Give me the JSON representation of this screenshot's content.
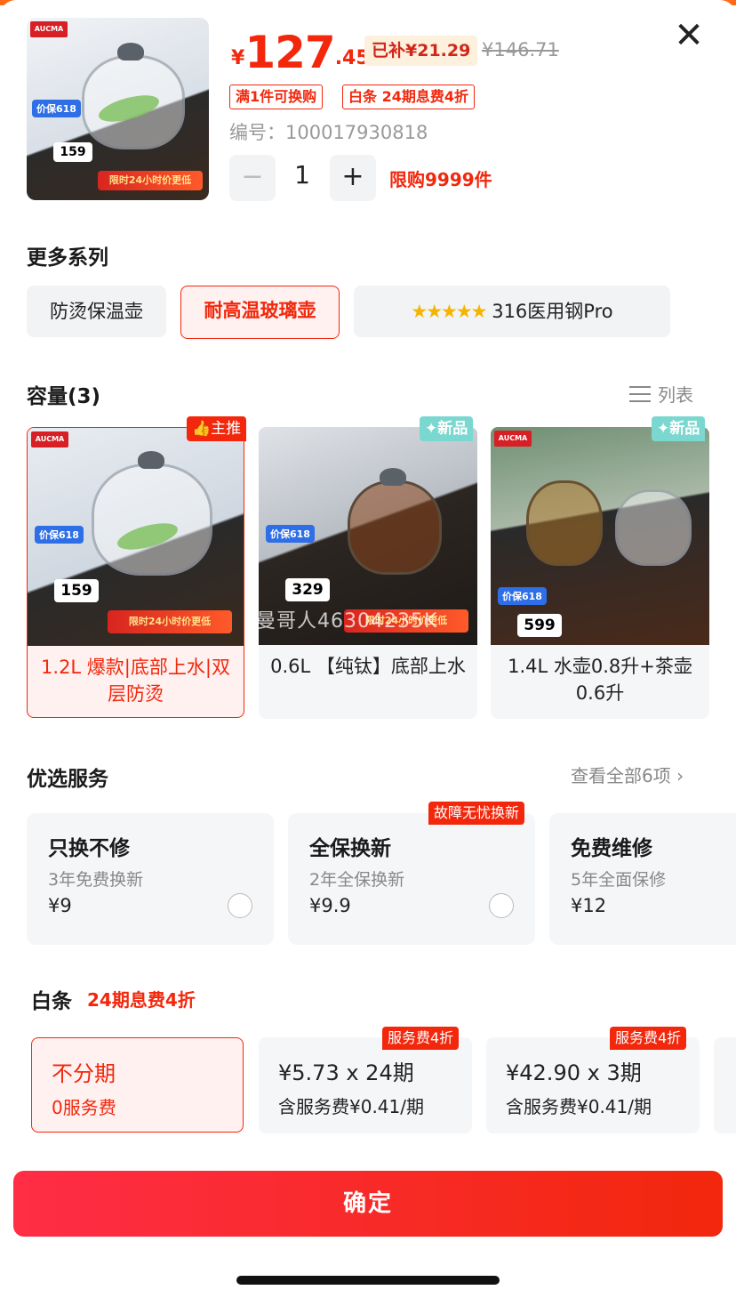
{
  "header": {
    "currency_symbol": "¥",
    "price_integer": "127",
    "price_decimal": ".45",
    "subsidy": "已补¥21.29",
    "original_price": "¥146.71",
    "promos": [
      "满1件可换购",
      "白条 24期息费4折"
    ],
    "sku": "编号：100017930818",
    "quantity": "1",
    "minus": "−",
    "plus": "+",
    "limit": "限购9999件",
    "close": "✕"
  },
  "thumb": {
    "brand": "AUCMA",
    "badge_618": "价保618",
    "price": "159",
    "banner": "限时24小时价更低"
  },
  "series": {
    "title": "更多系列",
    "items": [
      "防烫保温壶",
      "耐高温玻璃壶",
      "316医用钢Pro"
    ],
    "stars": "★★★★★",
    "active_index": 1
  },
  "capacity": {
    "title": "容量(3)",
    "toggle_label": "列表",
    "items": [
      {
        "label": "1.2L 爆款|底部上水|双层防烫",
        "badge": "主推",
        "price": "159"
      },
      {
        "label": "0.6L 【纯钛】底部上水",
        "badge": "✦新品",
        "price": "329"
      },
      {
        "label": "1.4L 水壶0.8升+茶壶0.6升",
        "badge": "✦新品",
        "price": "599"
      }
    ],
    "watermark": "曼哥人46304235K"
  },
  "services": {
    "title": "优选服务",
    "see_all": "查看全部6项 ›",
    "flag": "故障无忧换新",
    "items": [
      {
        "name": "只换不修",
        "desc": "3年免费换新",
        "price": "¥9"
      },
      {
        "name": "全保换新",
        "desc": "2年全保换新",
        "price": "¥9.9"
      },
      {
        "name": "免费维修",
        "desc": "5年全面保修",
        "price": "¥12"
      }
    ]
  },
  "baitiao": {
    "title": "白条",
    "subtitle": "24期息费4折",
    "flag": "服务费4折",
    "options": [
      {
        "main": "不分期",
        "sub": "0服务费"
      },
      {
        "main": "¥5.73 x 24期",
        "sub": "含服务费¥0.41/期"
      },
      {
        "main": "¥42.90 x 3期",
        "sub": "含服务费¥0.41/期"
      }
    ]
  },
  "confirm_label": "确定",
  "colors": {
    "accent": "#f2270c",
    "subsidy_bg": "#fdf0dd",
    "card_bg": "#f5f6f8",
    "new_badge": "#7bd8d0"
  }
}
